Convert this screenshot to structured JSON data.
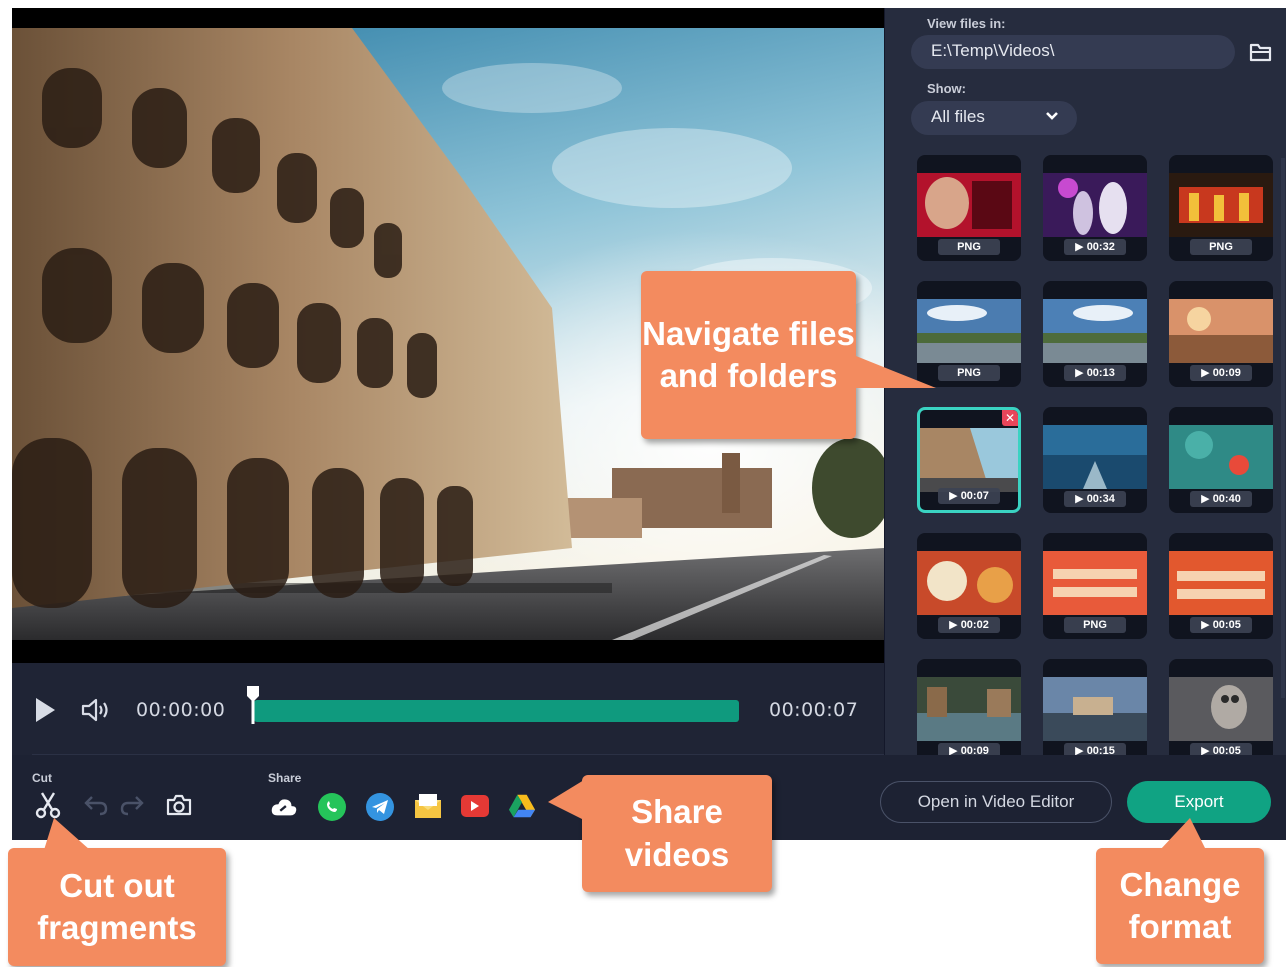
{
  "player": {
    "current_time": "00:00:00",
    "total_time": "00:00:07",
    "progress": 0
  },
  "toolbar": {
    "cut_label": "Cut",
    "share_label": "Share",
    "open_editor_label": "Open in Video Editor",
    "export_label": "Export"
  },
  "browser": {
    "view_files_label": "View files in:",
    "path_value": "E:\\Temp\\Videos\\",
    "show_label": "Show:",
    "show_value": "All files",
    "tiles": [
      {
        "badge": "PNG",
        "play": false
      },
      {
        "badge": "00:32",
        "play": true
      },
      {
        "badge": "PNG",
        "play": false
      },
      {
        "badge": "PNG",
        "play": false
      },
      {
        "badge": "00:13",
        "play": true
      },
      {
        "badge": "00:09",
        "play": true
      },
      {
        "badge": "00:07",
        "play": true,
        "selected": true
      },
      {
        "badge": "00:34",
        "play": true
      },
      {
        "badge": "00:40",
        "play": true
      },
      {
        "badge": "00:02",
        "play": true
      },
      {
        "badge": "PNG",
        "play": false
      },
      {
        "badge": "00:05",
        "play": true
      },
      {
        "badge": "00:09",
        "play": true
      },
      {
        "badge": "00:15",
        "play": true
      },
      {
        "badge": "00:05",
        "play": true
      }
    ]
  },
  "callouts": {
    "navigate": "Navigate files and folders",
    "share": "Share videos",
    "cut": "Cut out fragments",
    "format": "Change format"
  },
  "colors": {
    "accent": "#10a383",
    "callout": "#f38b5f",
    "selected_border": "#3ad3c2",
    "background": "#1d2233"
  }
}
